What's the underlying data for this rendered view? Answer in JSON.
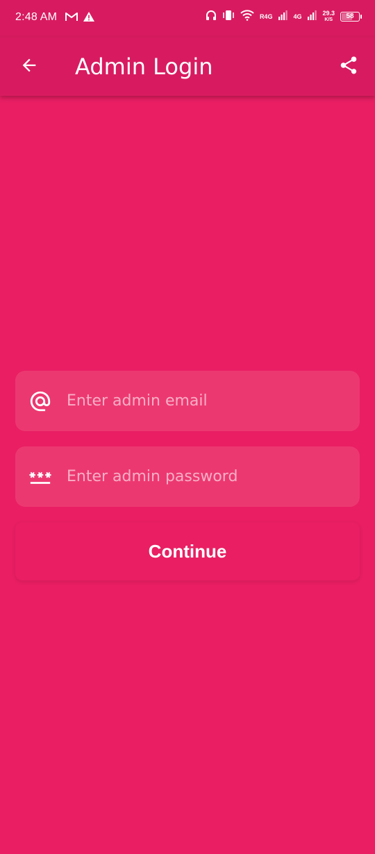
{
  "status_bar": {
    "time": "2:48 AM",
    "left_icons": [
      "gmail-icon",
      "warning-icon"
    ],
    "right_icons": [
      "headphones-icon",
      "vibrate-icon",
      "wifi-icon",
      "signal-r4g-icon",
      "signal-4g-icon"
    ],
    "network_label_1": "R4G",
    "network_label_2": "4G",
    "speed_value": "29.3",
    "speed_unit": "K/S",
    "battery_level": "58"
  },
  "app_bar": {
    "title": "Admin Login",
    "back_icon": "arrow-back-icon",
    "share_icon": "share-icon"
  },
  "form": {
    "email": {
      "icon": "at-icon",
      "value": "",
      "placeholder": "Enter admin email"
    },
    "password": {
      "icon": "password-icon",
      "value": "",
      "placeholder": "Enter admin password"
    },
    "continue_label": "Continue"
  },
  "colors": {
    "background": "#E91E63",
    "app_bar": "#D81B60",
    "field_background": "#EC3871",
    "text": "#FFFFFF"
  }
}
